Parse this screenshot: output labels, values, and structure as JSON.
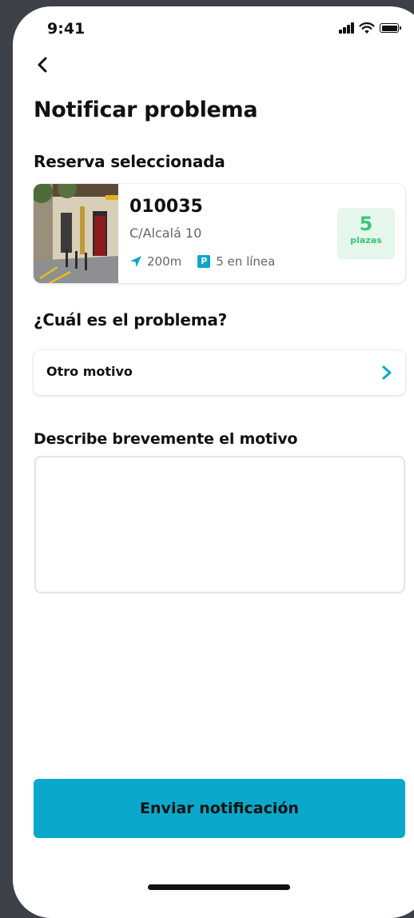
{
  "status_bar": {
    "time": "9:41"
  },
  "header": {
    "back_icon": "chevron-left-icon",
    "title": "Notificar problema"
  },
  "reservation": {
    "section_title": "Reserva seleccionada",
    "code": "010035",
    "address": "C/Alcalá 10",
    "distance": "200m",
    "parking": "5 en línea",
    "parking_icon_letter": "P",
    "spots_count": "5",
    "spots_label": "plazas"
  },
  "problem": {
    "section_title": "¿Cuál es el problema?",
    "selected_reason": "Otro motivo"
  },
  "description": {
    "section_title": "Describe brevemente el motivo",
    "value": ""
  },
  "submit": {
    "label": "Enviar notificación"
  },
  "colors": {
    "accent": "#0aa8cb",
    "badge_bg": "#e5f6ec",
    "badge_text": "#3cc57a",
    "text": "#111111",
    "muted": "#666666"
  }
}
